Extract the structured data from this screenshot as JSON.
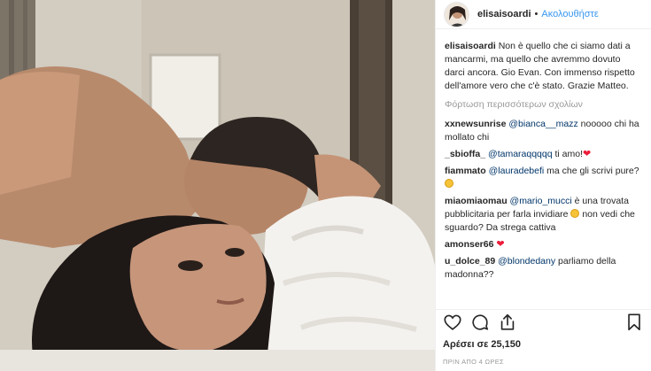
{
  "post": {
    "username": "elisaisoardi",
    "separator": "•",
    "follow_label": "Ακολουθήστε",
    "caption": {
      "username": "elisaisoardi",
      "text": "Non è quello che ci siamo dati a mancarmi, ma quello che avremmo dovuto darci ancora. Gio Evan. Con immenso rispetto dell'amore vero che c'è stato. Grazie Matteo."
    },
    "load_more": "Φόρτωση περισσότερων σχολίων",
    "comments": [
      {
        "username": "xxnewsunrise",
        "mention": "@bianca__mazz",
        "text": " nooooo chi ha mollato chi"
      },
      {
        "username": "_sbioffa_",
        "mention": "@tamaraqqqqq",
        "text": " ti amo!",
        "emoji": "red-heart"
      },
      {
        "username": "fiammato",
        "mention": "@lauradebefi",
        "text": " ma che gli scrivi pure?",
        "emoji": "laughing-face"
      },
      {
        "username": "miaomiaomau",
        "mention": "@mario_mucci",
        "text": " è una trovata pubblicitaria per farla invidiare ",
        "emoji": "laughing-face",
        "text_after": " non vedi che sguardo? Da strega cattiva"
      },
      {
        "username": "amonser66",
        "mention": "",
        "text": "",
        "emoji": "red-heart"
      },
      {
        "username": "u_dolce_89",
        "mention": "@blondedany",
        "text": " parliamo della madonna??"
      }
    ],
    "likes_text": "Αρέσει σε 25,150",
    "timestamp": "ΠΡΙΝ ΑΠΟ 4 ΩΡΕΣ",
    "icons": [
      "heart-icon",
      "comment-icon",
      "share-icon",
      "bookmark-icon"
    ],
    "colors": {
      "link": "#3897f0",
      "mention": "#003569",
      "muted": "#999999",
      "heart": "#ed1c3a"
    }
  }
}
